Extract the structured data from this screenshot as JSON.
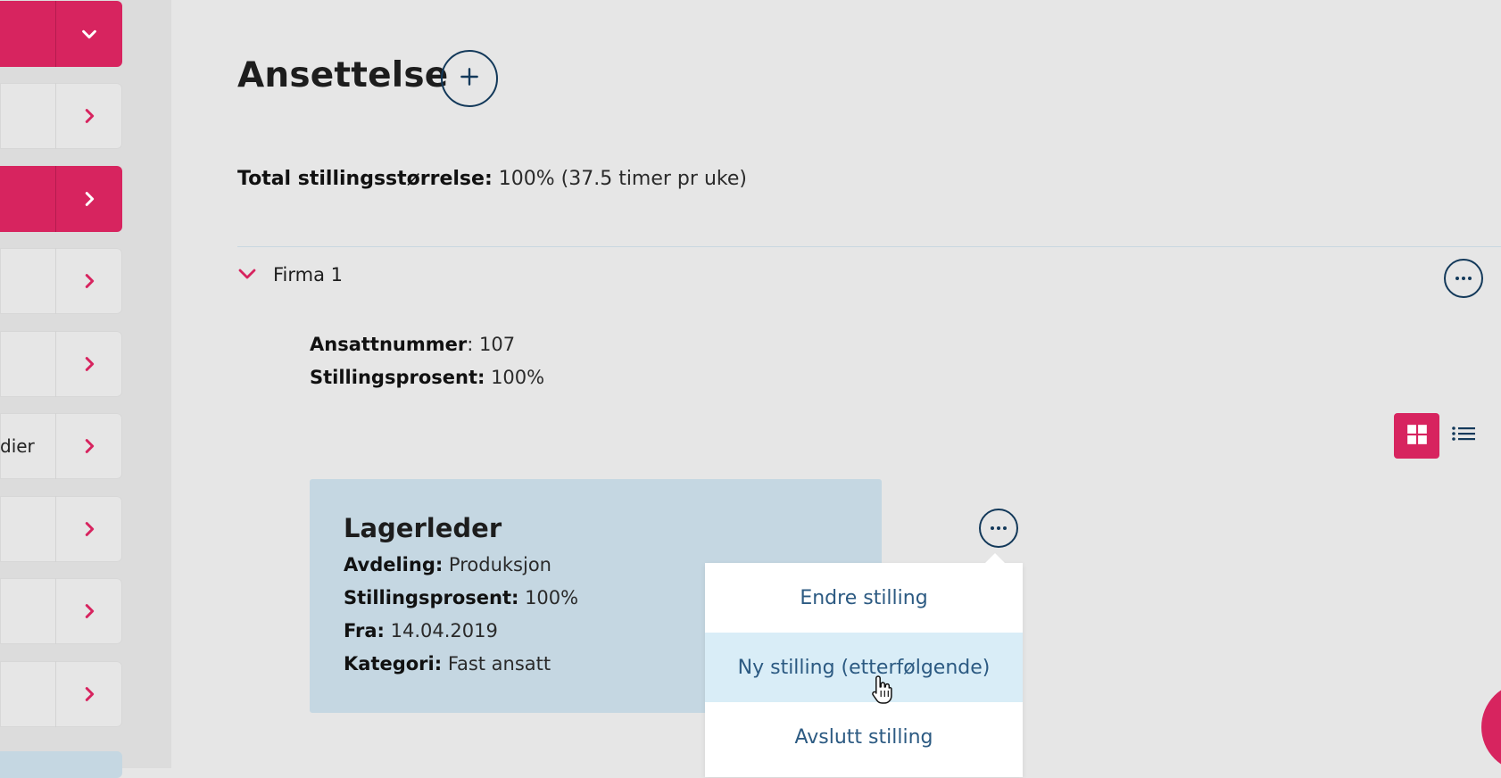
{
  "sidebar": {
    "items": [
      {
        "label": "",
        "active": true,
        "chevron": "chevron-down-icon"
      },
      {
        "label": "",
        "active": false,
        "chevron": "chevron-right-icon"
      },
      {
        "label": "",
        "active": true,
        "chevron": "chevron-right-icon"
      },
      {
        "label": "",
        "active": false,
        "chevron": "chevron-right-icon"
      },
      {
        "label": "",
        "active": false,
        "chevron": "chevron-right-icon"
      },
      {
        "label": "dier",
        "active": false,
        "chevron": "chevron-right-icon"
      },
      {
        "label": "",
        "active": false,
        "chevron": "chevron-right-icon"
      },
      {
        "label": "",
        "active": false,
        "chevron": "chevron-right-icon"
      },
      {
        "label": "",
        "active": false,
        "chevron": "chevron-right-icon"
      }
    ]
  },
  "page": {
    "title": "Ansettelse",
    "add_icon": "plus-icon"
  },
  "total": {
    "label": "Total stillingsstørrelse:",
    "value": " 100% (37.5 timer pr uke)"
  },
  "firm": {
    "name": "Firma 1",
    "employee_number_label": "Ansattnummer",
    "employee_number_value": ": 107",
    "percent_label": "Stillingsprosent:",
    "percent_value": " 100%"
  },
  "view_toggle": {
    "active": "grid-view-icon",
    "other": "list-view-icon"
  },
  "position_card": {
    "title": "Lagerleder",
    "department_label": "Avdeling:",
    "department_value": " Produksjon",
    "percent_label": "Stillingsprosent:",
    "percent_value": " 100%",
    "from_label": "Fra:",
    "from_value": " 14.04.2019",
    "category_label": "Kategori:",
    "category_value": " Fast ansatt"
  },
  "dropdown": {
    "items": [
      {
        "label": "Endre stilling",
        "hover": false
      },
      {
        "label": "Ny stilling (etterfølgende)",
        "hover": true
      },
      {
        "label": "Avslutt stilling",
        "hover": false
      }
    ]
  },
  "colors": {
    "accent": "#d7245f",
    "navy": "#13395a",
    "card_bg": "#c5d7e2",
    "link": "#2c5a82",
    "hover_bg": "#d9edf7"
  }
}
